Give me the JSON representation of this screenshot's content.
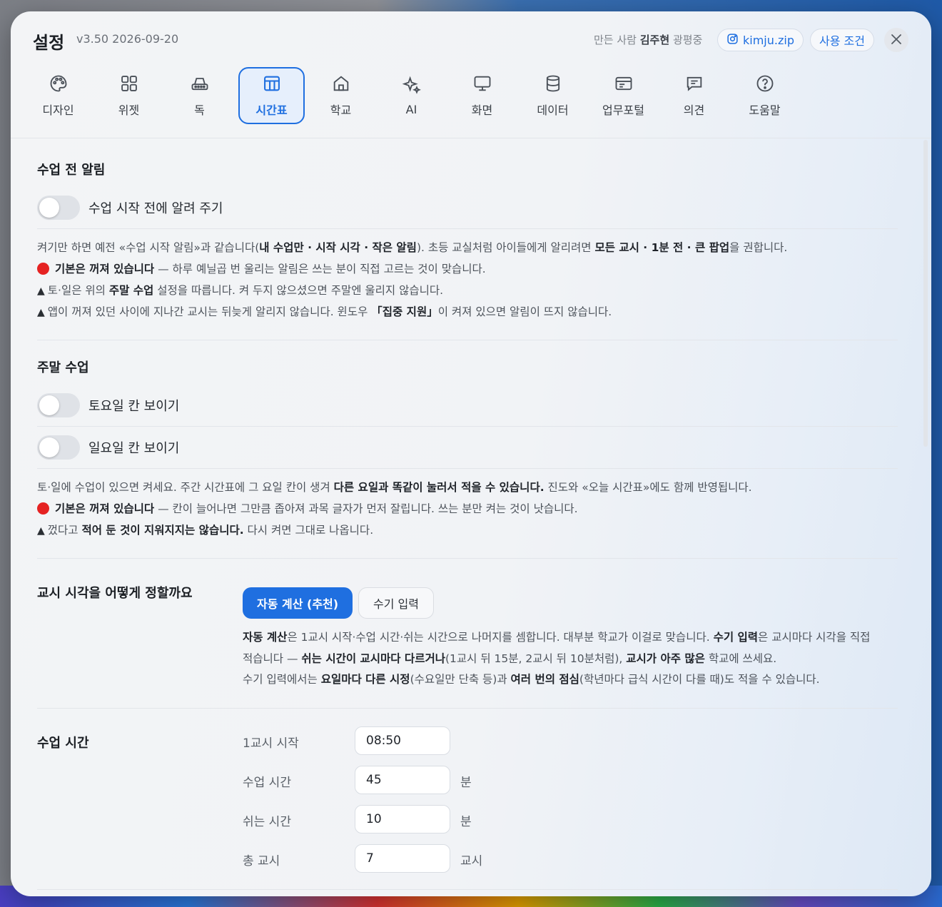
{
  "header": {
    "title": "설정",
    "version": "v3.50 2026-09-20",
    "maker_prefix": "만든 사람",
    "maker_name": "김주현",
    "maker_suffix": "광평중",
    "instagram_label": "kimju.zip",
    "terms_label": "사용 조건"
  },
  "tabs": [
    {
      "label": "디자인",
      "icon": "palette-icon"
    },
    {
      "label": "위젯",
      "icon": "widgets-grid-icon"
    },
    {
      "label": "독",
      "icon": "dock-icon"
    },
    {
      "label": "시간표",
      "icon": "timetable-icon",
      "active": true
    },
    {
      "label": "학교",
      "icon": "school-icon"
    },
    {
      "label": "AI",
      "icon": "sparkle-icon"
    },
    {
      "label": "화면",
      "icon": "monitor-icon"
    },
    {
      "label": "데이터",
      "icon": "database-icon"
    },
    {
      "label": "업무포털",
      "icon": "portal-icon"
    },
    {
      "label": "의견",
      "icon": "feedback-icon"
    },
    {
      "label": "도움말",
      "icon": "help-icon"
    }
  ],
  "alert_section": {
    "title": "수업 전 알림",
    "toggle_label": "수업 시작 전에 알려 주기",
    "toggle_on": false,
    "note1_a": "켜기만 하면 예전 «수업 시작 알림»과 같습니다(",
    "note1_b": "내 수업만 · 시작 시각 · 작은 알림",
    "note1_c": "). 초등 교실처럼 아이들에게 알리려면 ",
    "note1_d": "모든 교시 · 1분 전 · 큰 팝업",
    "note1_e": "을 권합니다.",
    "note2_a": "기본은 꺼져 있습니다",
    "note2_b": " — 하루 예닐곱 번 울리는 알림은 쓰는 분이 직접 고르는 것이 맞습니다.",
    "note3_a": "토·일은 위의 ",
    "note3_b": "주말 수업",
    "note3_c": " 설정을 따릅니다. 켜 두지 않으셨으면 주말엔 울리지 않습니다.",
    "note4_a": "앱이 꺼져 있던 사이에 지나간 교시는 뒤늦게 알리지 않습니다. 윈도우 ",
    "note4_b": "「집중 지원」",
    "note4_c": "이 켜져 있으면 알림이 뜨지 않습니다."
  },
  "weekend_section": {
    "title": "주말 수업",
    "saturday_label": "토요일 칸 보이기",
    "sunday_label": "일요일 칸 보이기",
    "saturday_on": false,
    "sunday_on": false,
    "note1_a": "토·일에 수업이 있으면 켜세요. 주간 시간표에 그 요일 칸이 생겨 ",
    "note1_b": "다른 요일과 똑같이 눌러서 적을 수 있습니다.",
    "note1_c": " 진도와 «오늘 시간표»에도 함께 반영됩니다.",
    "note2_a": "기본은 꺼져 있습니다",
    "note2_b": " — 칸이 늘어나면 그만큼 좁아져 과목 글자가 먼저 잘립니다. 쓰는 분만 켜는 것이 낫습니다.",
    "note3_a": "껐다고 ",
    "note3_b": "적어 둔 것이 지워지지는 않습니다.",
    "note3_c": " 다시 켜면 그대로 나옵니다."
  },
  "timing_section": {
    "title": "교시 시각을 어떻게 정할까요",
    "auto_label": "자동 계산 (추천)",
    "manual_label": "수기 입력",
    "selected": "자동 계산 (추천)",
    "desc1_a": "자동 계산",
    "desc1_b": "은 1교시 시작·수업 시간·쉬는 시간으로 나머지를 셈합니다. 대부분 학교가 이걸로 맞습니다. ",
    "desc1_c": "수기 입력",
    "desc1_d": "은 교시마다 시각을 직접",
    "desc2_a": "적습니다 — ",
    "desc2_b": "쉬는 시간이 교시마다 다르거나",
    "desc2_c": "(1교시 뒤 15분, 2교시 뒤 10분처럼), ",
    "desc2_d": "교시가 아주 많은",
    "desc2_e": " 학교에 쓰세요.",
    "desc3_a": "수기 입력에서는 ",
    "desc3_b": "요일마다 다른 시정",
    "desc3_c": "(수요일만 단축 등)과 ",
    "desc3_d": "여러 번의 점심",
    "desc3_e": "(학년마다 급식 시간이 다를 때)도 적을 수 있습니다."
  },
  "class_time_section": {
    "title": "수업 시간",
    "fields": [
      {
        "label": "1교시 시작",
        "value": "08:50",
        "unit": ""
      },
      {
        "label": "수업 시간",
        "value": "45",
        "unit": "분"
      },
      {
        "label": "쉬는 시간",
        "value": "10",
        "unit": "분"
      },
      {
        "label": "총 교시",
        "value": "7",
        "unit": "교시"
      }
    ]
  },
  "colors": {
    "accent": "#1f6fe0",
    "status_red": "#e52222"
  }
}
